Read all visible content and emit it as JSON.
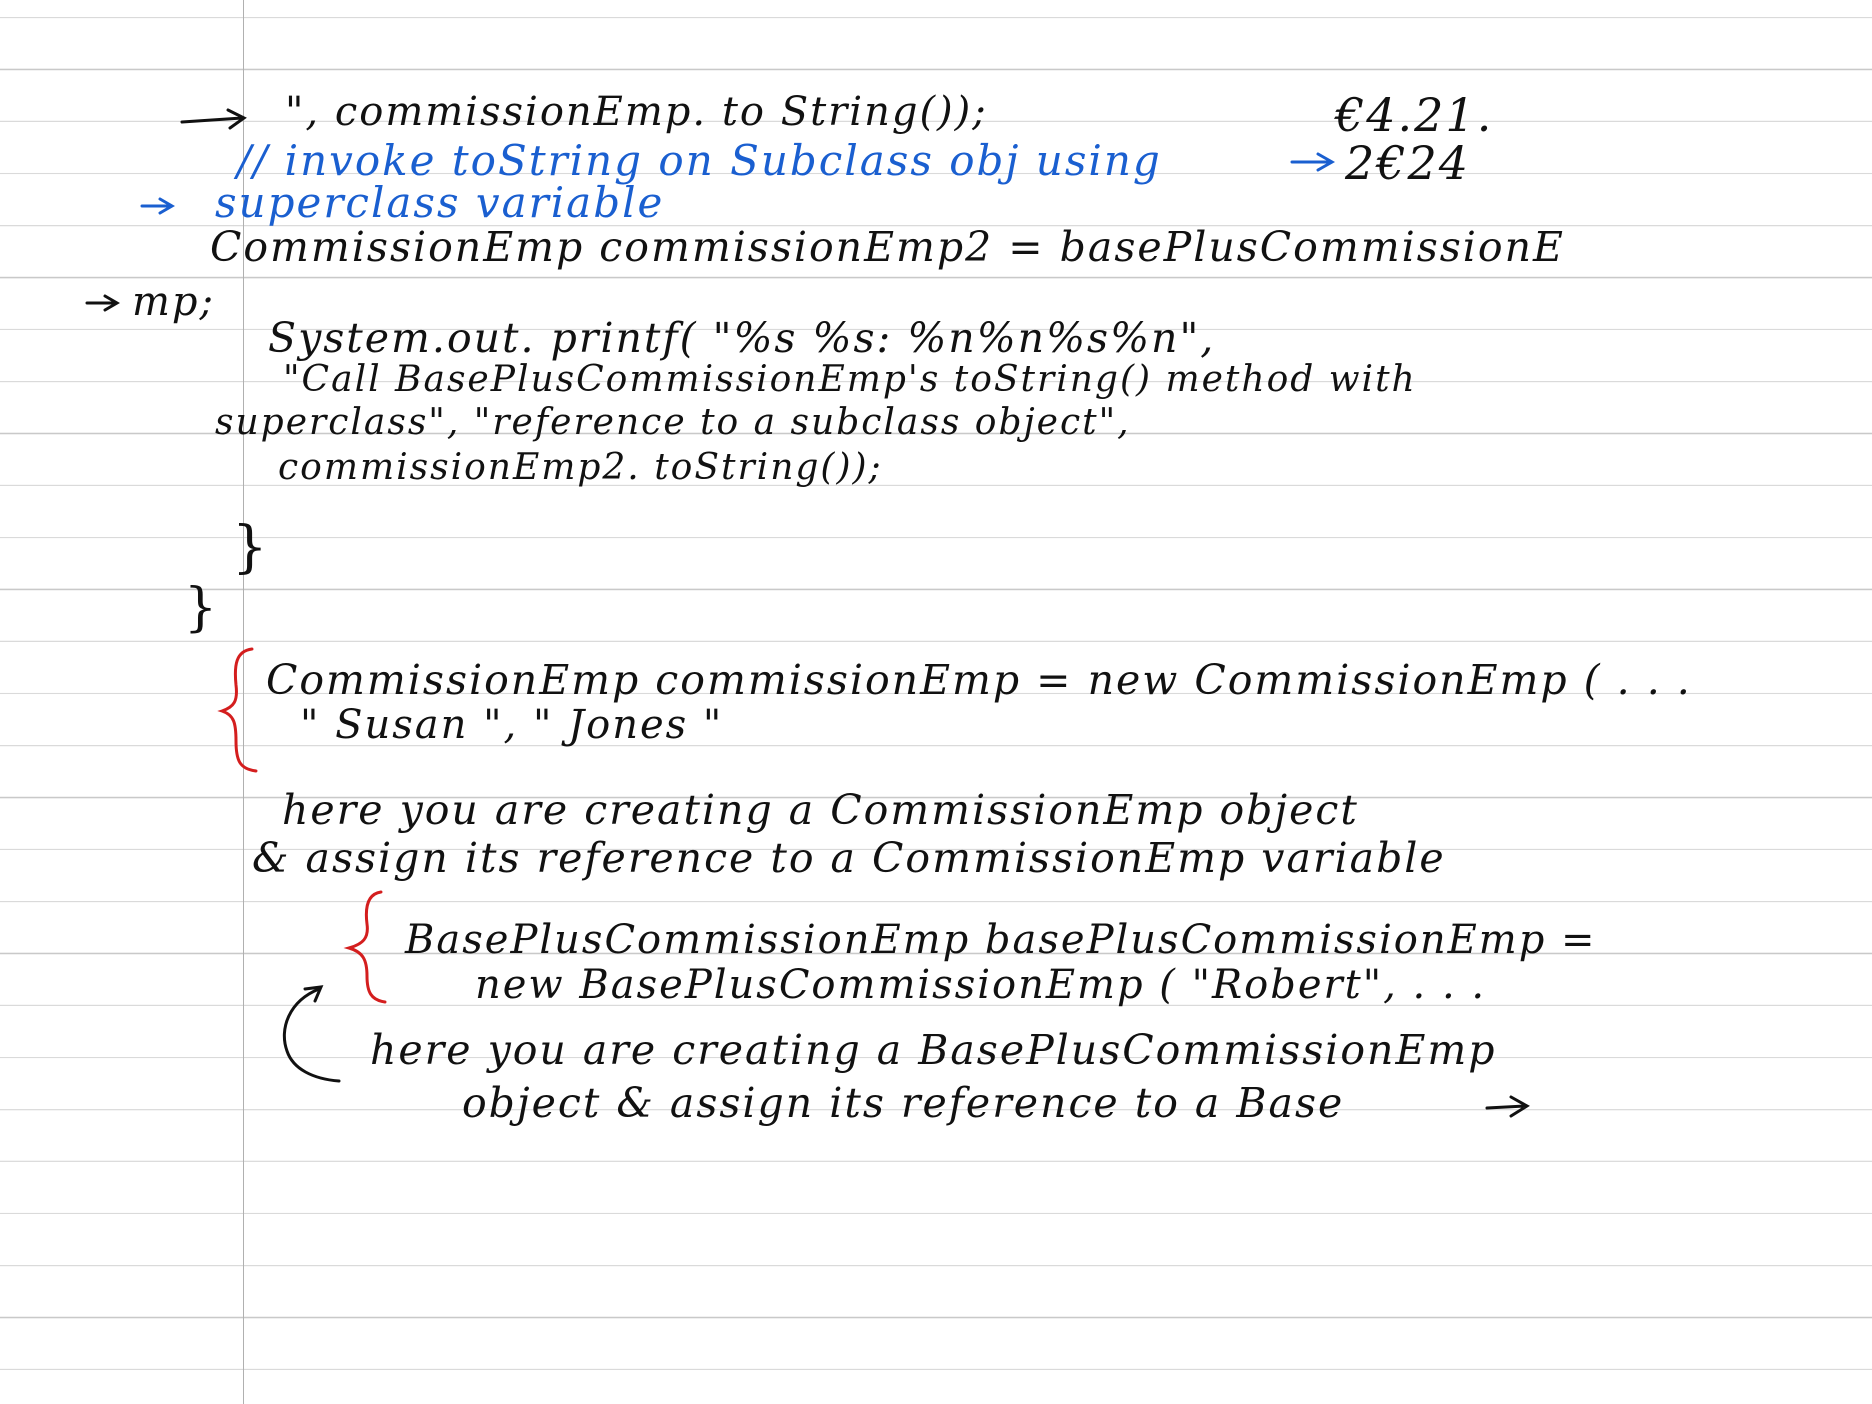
{
  "page": {
    "lines": [
      {
        "id": "l1",
        "text": "\", commissionEmp. to String());",
        "color": "black"
      },
      {
        "id": "l1b",
        "text": "€4.21.",
        "color": "black"
      },
      {
        "id": "l2",
        "text": "// invoke   toString   on   Subclass  obj  using",
        "color": "blue"
      },
      {
        "id": "l2b",
        "text": "2€24",
        "color": "black"
      },
      {
        "id": "l3",
        "text": "superclass   variable",
        "color": "blue"
      },
      {
        "id": "l4",
        "text": "CommissionEmp   commissionEmp2   =   basePlusCommissionE",
        "color": "black"
      },
      {
        "id": "l5",
        "text": "mp;",
        "color": "black"
      },
      {
        "id": "l6",
        "text": "System.out. printf( \"%s   %s:  %n%n%s%n\",",
        "color": "black"
      },
      {
        "id": "l7",
        "text": "\"Call  BasePlusCommissionEmp's  toString()  method  with",
        "color": "black"
      },
      {
        "id": "l8",
        "text": "superclass\",   \"reference  to  a  subclass  object\",",
        "color": "black"
      },
      {
        "id": "l9",
        "text": "commissionEmp2. toString());",
        "color": "black"
      },
      {
        "id": "l10",
        "text": "}",
        "color": "black"
      },
      {
        "id": "l11",
        "text": "}",
        "color": "black"
      },
      {
        "id": "l12",
        "text": "CommissionEmp  commissionEmp = new  CommissionEmp ( . . .",
        "color": "black"
      },
      {
        "id": "l13",
        "text": "\" Susan \",    \" Jones \"",
        "color": "black"
      },
      {
        "id": "l14",
        "text": "here  you  are  creating  a  CommissionEmp  object",
        "color": "black"
      },
      {
        "id": "l15",
        "text": "&  assign  its  reference  to  a  CommissionEmp  variable",
        "color": "black"
      },
      {
        "id": "l16",
        "text": "BasePlusCommissionEmp  basePlusCommissionEmp  =",
        "color": "black"
      },
      {
        "id": "l17",
        "text": "new  BasePlusCommissionEmp ( \"Robert\", . . .",
        "color": "black"
      },
      {
        "id": "l18",
        "text": "here  you  are  creating  a  BasePlusCommissionEmp",
        "color": "black"
      },
      {
        "id": "l19",
        "text": "object  &  assign  its  reference  to  a  Base",
        "color": "black"
      }
    ],
    "colors": {
      "ink_black": "#111111",
      "ink_blue": "#1a5fd0",
      "ink_red": "#d41e1e",
      "rule_line": "#c9c9c9",
      "margin_line": "#b0b0b0"
    }
  }
}
